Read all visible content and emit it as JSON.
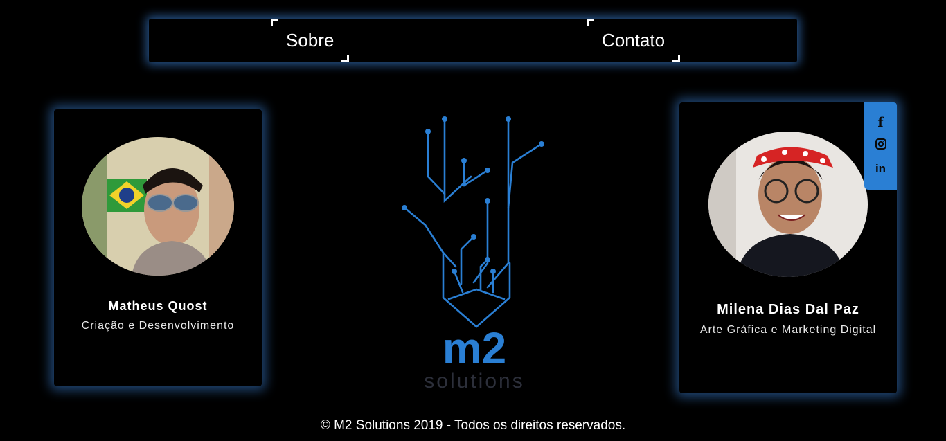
{
  "nav": {
    "links": [
      {
        "label": "Sobre"
      },
      {
        "label": "Contato"
      }
    ]
  },
  "members": [
    {
      "name": "Matheus Quost",
      "role": "Criação e Desenvolvimento"
    },
    {
      "name": "Milena Dias Dal Paz",
      "role": "Arte Gráfica e Marketing Digital"
    }
  ],
  "social_icons": [
    "facebook-icon",
    "instagram-icon",
    "linkedin-icon"
  ],
  "social_glyphs": {
    "facebook": "f",
    "linkedin": "in"
  },
  "logo": {
    "line1": "m2",
    "line2": "solutions"
  },
  "footer": {
    "text": "© M2 Solutions 2019 - Todos os direitos reservados."
  },
  "colors": {
    "accent": "#2a7fd4",
    "logo_dark": "#2c2f3a",
    "background": "#000000"
  }
}
